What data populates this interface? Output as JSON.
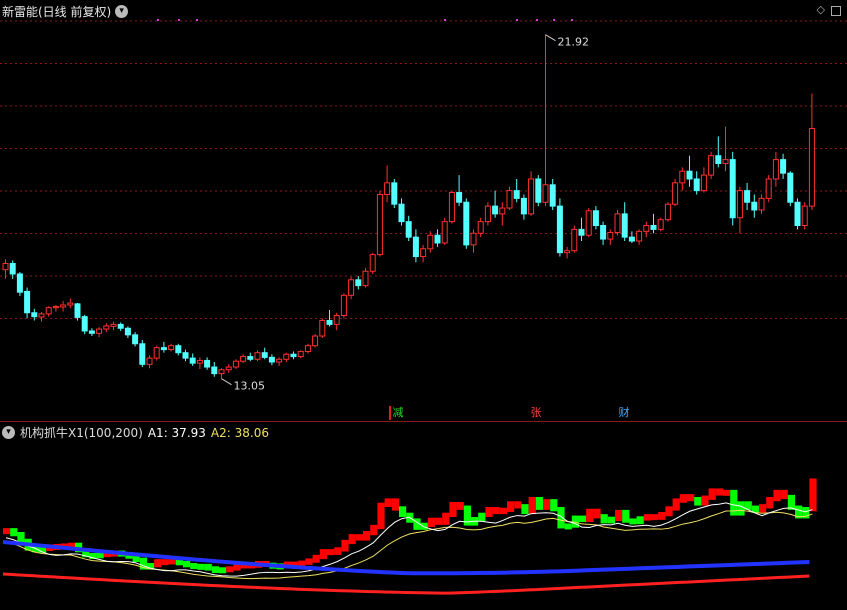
{
  "main_chart": {
    "title": "新雷能(日线 前复权)",
    "menu_icon": "chevron-down-icon",
    "high_label": "21.92",
    "low_label": "13.05",
    "corner_icons": [
      "diamond-icon",
      "square-icon"
    ],
    "badges": [
      {
        "text": "减",
        "color": "#22dd22"
      },
      {
        "text": "张",
        "color": "#ff4444"
      },
      {
        "text": "财",
        "color": "#44aaff"
      }
    ],
    "colors": {
      "up": "#ff3030",
      "down": "#54ffff",
      "grid": "#8a1a1a",
      "marker": "#cc44cc"
    }
  },
  "sub_chart": {
    "title": "机构抓牛X1(100,200)",
    "a1_label": "A1: 37.93",
    "a2_label": "A2: 38.06",
    "colors": {
      "bull": "#ff0000",
      "bear": "#00ff00",
      "blue": "#2233ff",
      "red": "#ff2020"
    }
  },
  "chart_data": {
    "type": "candlestick",
    "ylim": [
      12.5,
      22.3
    ],
    "candles": [
      [
        15.86,
        16.13,
        15.63,
        16.02
      ],
      [
        16.02,
        16.1,
        15.62,
        15.75
      ],
      [
        15.75,
        15.8,
        15.18,
        15.28
      ],
      [
        15.3,
        15.4,
        14.61,
        14.75
      ],
      [
        14.75,
        14.85,
        14.55,
        14.65
      ],
      [
        14.64,
        14.77,
        14.52,
        14.72
      ],
      [
        14.72,
        14.92,
        14.65,
        14.88
      ],
      [
        14.88,
        14.95,
        14.78,
        14.91
      ],
      [
        14.9,
        15.05,
        14.78,
        14.95
      ],
      [
        14.95,
        15.12,
        14.87,
        15.0
      ],
      [
        14.98,
        15.0,
        14.55,
        14.63
      ],
      [
        14.65,
        14.7,
        14.2,
        14.28
      ],
      [
        14.28,
        14.35,
        14.15,
        14.22
      ],
      [
        14.22,
        14.38,
        14.12,
        14.33
      ],
      [
        14.33,
        14.48,
        14.25,
        14.41
      ],
      [
        14.4,
        14.52,
        14.3,
        14.45
      ],
      [
        14.45,
        14.5,
        14.28,
        14.35
      ],
      [
        14.35,
        14.4,
        14.1,
        14.18
      ],
      [
        14.18,
        14.25,
        13.88,
        13.95
      ],
      [
        13.95,
        14.05,
        13.35,
        13.42
      ],
      [
        13.42,
        13.65,
        13.32,
        13.58
      ],
      [
        13.58,
        13.9,
        13.52,
        13.85
      ],
      [
        13.85,
        14.0,
        13.72,
        13.8
      ],
      [
        13.8,
        13.95,
        13.75,
        13.9
      ],
      [
        13.9,
        13.95,
        13.65,
        13.72
      ],
      [
        13.72,
        13.8,
        13.5,
        13.58
      ],
      [
        13.58,
        13.7,
        13.38,
        13.45
      ],
      [
        13.45,
        13.6,
        13.3,
        13.52
      ],
      [
        13.52,
        13.6,
        13.28,
        13.35
      ],
      [
        13.35,
        13.48,
        13.1,
        13.18
      ],
      [
        13.18,
        13.32,
        13.05,
        13.28
      ],
      [
        13.28,
        13.42,
        13.2,
        13.35
      ],
      [
        13.35,
        13.55,
        13.3,
        13.5
      ],
      [
        13.5,
        13.68,
        13.45,
        13.62
      ],
      [
        13.62,
        13.72,
        13.5,
        13.55
      ],
      [
        13.55,
        13.78,
        13.5,
        13.72
      ],
      [
        13.72,
        13.85,
        13.55,
        13.6
      ],
      [
        13.6,
        13.68,
        13.4,
        13.48
      ],
      [
        13.48,
        13.6,
        13.38,
        13.55
      ],
      [
        13.55,
        13.72,
        13.48,
        13.68
      ],
      [
        13.68,
        13.75,
        13.55,
        13.62
      ],
      [
        13.62,
        13.78,
        13.58,
        13.75
      ],
      [
        13.75,
        13.95,
        13.7,
        13.9
      ],
      [
        13.9,
        14.2,
        13.85,
        14.15
      ],
      [
        14.15,
        14.6,
        14.1,
        14.55
      ],
      [
        14.55,
        14.82,
        14.4,
        14.45
      ],
      [
        14.45,
        14.75,
        14.3,
        14.68
      ],
      [
        14.68,
        15.25,
        14.6,
        15.2
      ],
      [
        15.2,
        15.68,
        15.1,
        15.6
      ],
      [
        15.6,
        15.7,
        15.35,
        15.45
      ],
      [
        15.45,
        15.9,
        15.4,
        15.82
      ],
      [
        15.82,
        16.3,
        15.75,
        16.25
      ],
      [
        16.25,
        17.9,
        16.2,
        17.8
      ],
      [
        17.8,
        18.55,
        17.6,
        18.1
      ],
      [
        18.1,
        18.2,
        17.45,
        17.55
      ],
      [
        17.55,
        17.7,
        17.0,
        17.1
      ],
      [
        17.1,
        17.25,
        16.6,
        16.7
      ],
      [
        16.7,
        16.9,
        16.05,
        16.2
      ],
      [
        16.2,
        16.5,
        16.05,
        16.4
      ],
      [
        16.4,
        16.85,
        16.3,
        16.75
      ],
      [
        16.75,
        16.9,
        16.45,
        16.55
      ],
      [
        16.55,
        17.2,
        16.5,
        17.1
      ],
      [
        17.1,
        17.9,
        17.05,
        17.85
      ],
      [
        17.85,
        18.3,
        17.5,
        17.6
      ],
      [
        17.6,
        17.7,
        16.4,
        16.5
      ],
      [
        16.5,
        16.9,
        16.3,
        16.8
      ],
      [
        16.8,
        17.2,
        16.7,
        17.1
      ],
      [
        17.1,
        17.6,
        17.0,
        17.5
      ],
      [
        17.5,
        17.9,
        17.2,
        17.3
      ],
      [
        17.3,
        17.6,
        17.0,
        17.45
      ],
      [
        17.45,
        18.0,
        17.4,
        17.9
      ],
      [
        17.9,
        18.2,
        17.6,
        17.7
      ],
      [
        17.7,
        17.8,
        17.15,
        17.3
      ],
      [
        17.3,
        18.4,
        17.25,
        18.2
      ],
      [
        18.2,
        18.3,
        17.5,
        17.6
      ],
      [
        17.6,
        21.92,
        17.5,
        18.05
      ],
      [
        18.05,
        18.2,
        17.4,
        17.5
      ],
      [
        17.5,
        17.7,
        16.2,
        16.3
      ],
      [
        16.3,
        16.45,
        16.15,
        16.35
      ],
      [
        16.35,
        17.0,
        16.3,
        16.9
      ],
      [
        16.9,
        17.2,
        16.6,
        16.75
      ],
      [
        16.75,
        17.45,
        16.7,
        17.38
      ],
      [
        17.38,
        17.5,
        16.9,
        17.0
      ],
      [
        17.0,
        17.1,
        16.5,
        16.65
      ],
      [
        16.65,
        16.9,
        16.5,
        16.82
      ],
      [
        16.82,
        17.4,
        16.75,
        17.3
      ],
      [
        17.3,
        17.6,
        16.6,
        16.7
      ],
      [
        16.7,
        16.85,
        16.55,
        16.6
      ],
      [
        16.6,
        16.9,
        16.5,
        16.85
      ],
      [
        16.85,
        17.1,
        16.7,
        17.0
      ],
      [
        17.0,
        17.3,
        16.8,
        16.9
      ],
      [
        16.9,
        17.2,
        16.85,
        17.15
      ],
      [
        17.15,
        17.6,
        17.1,
        17.55
      ],
      [
        17.55,
        18.2,
        17.5,
        18.1
      ],
      [
        18.1,
        18.5,
        17.9,
        18.4
      ],
      [
        18.4,
        18.8,
        18.0,
        18.2
      ],
      [
        18.2,
        18.4,
        17.8,
        17.9
      ],
      [
        17.9,
        18.5,
        17.85,
        18.3
      ],
      [
        18.3,
        18.9,
        18.2,
        18.8
      ],
      [
        18.8,
        19.3,
        18.5,
        18.6
      ],
      [
        18.6,
        19.55,
        18.4,
        18.7
      ],
      [
        18.7,
        18.9,
        17.0,
        17.2
      ],
      [
        17.2,
        18.0,
        16.8,
        17.9
      ],
      [
        17.9,
        18.1,
        17.4,
        17.6
      ],
      [
        17.6,
        17.8,
        17.2,
        17.4
      ],
      [
        17.4,
        17.8,
        17.3,
        17.7
      ],
      [
        17.7,
        18.3,
        17.6,
        18.2
      ],
      [
        18.2,
        18.9,
        18.0,
        18.7
      ],
      [
        18.7,
        18.85,
        18.2,
        18.35
      ],
      [
        18.35,
        18.4,
        17.5,
        17.6
      ],
      [
        17.6,
        17.7,
        16.9,
        17.0
      ],
      [
        17.0,
        17.6,
        16.9,
        17.5
      ],
      [
        17.5,
        20.4,
        17.4,
        19.5
      ]
    ]
  }
}
